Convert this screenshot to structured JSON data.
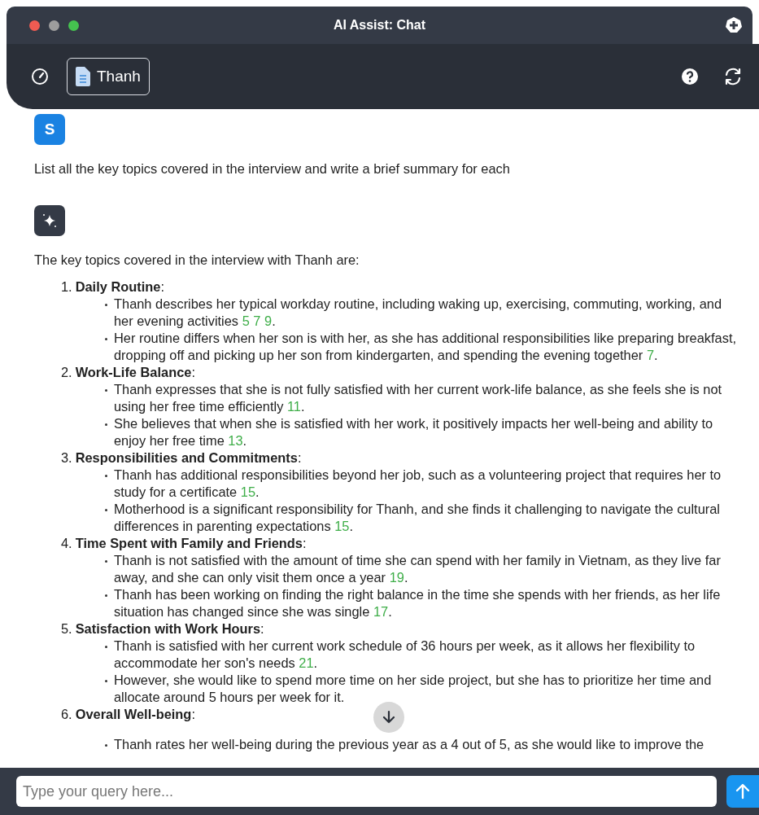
{
  "window": {
    "title": "AI Assist: Chat"
  },
  "toolbar": {
    "document_button": "Thanh"
  },
  "messages": [
    {
      "kind": "user",
      "avatar": "S",
      "text": "List all the key topics covered in the interview and write a brief summary for each"
    },
    {
      "kind": "assistant",
      "intro": "The key topics covered in the interview with Thanh are:",
      "topics": [
        {
          "number": "1.",
          "title": "Daily Routine",
          "after": ":",
          "bullets": [
            {
              "text": "Thanh describes her typical workday routine, including waking up, exercising, commuting, working, and her evening activities",
              "citations": [
                "5",
                "7",
                "9"
              ],
              "end": "."
            },
            {
              "text": "Her routine differs when her son is with her, as she has additional responsibilities like preparing breakfast, dropping off and picking up her son from kindergarten, and spending the evening together",
              "citations": [
                "7"
              ],
              "end": "."
            }
          ]
        },
        {
          "number": "2.",
          "title": "Work-Life Balance",
          "after": ":",
          "bullets": [
            {
              "text": "Thanh expresses that she is not fully satisfied with her current work-life balance, as she feels she is not using her free time efficiently",
              "citations": [
                "11"
              ],
              "end": "."
            },
            {
              "text": "She believes that when she is satisfied with her work, it positively impacts her well-being and ability to enjoy her free time",
              "citations": [
                "13"
              ],
              "end": "."
            }
          ]
        },
        {
          "number": "3.",
          "title": "Responsibilities and Commitments",
          "after": ":",
          "bullets": [
            {
              "text": "Thanh has additional responsibilities beyond her job, such as a volunteering project that requires her to study for a certificate",
              "citations": [
                "15"
              ],
              "end": "."
            },
            {
              "text": "Motherhood is a significant responsibility for Thanh, and she finds it challenging to navigate the cultural differences in parenting expectations",
              "citations": [
                "15"
              ],
              "end": "."
            }
          ]
        },
        {
          "number": "4.",
          "title": "Time Spent with Family and Friends",
          "after": ":",
          "bullets": [
            {
              "text": "Thanh is not satisfied with the amount of time she can spend with her family in Vietnam, as they live far away, and she can only visit them once a year",
              "citations": [
                "19"
              ],
              "end": "."
            },
            {
              "text": "Thanh has been working on finding the right balance in the time she spends with her friends, as her life situation has changed since she was single",
              "citations": [
                "17"
              ],
              "end": "."
            }
          ]
        },
        {
          "number": "5.",
          "title": "Satisfaction with Work Hours",
          "after": ":",
          "bullets": [
            {
              "text": "Thanh is satisfied with her current work schedule of 36 hours per week, as it allows her flexibility to accommodate her son's needs",
              "citations": [
                "21"
              ],
              "end": "."
            },
            {
              "text": "However, she would like to spend more time on her side project, but she has to prioritize her time and allocate around 5 hours per week for it",
              "end": "."
            }
          ]
        },
        {
          "number": "6.",
          "title": "Overall Well-being",
          "after": ":",
          "bullets": [
            {
              "text": "Thanh rates her well-being during the previous year as a 4 out of 5, as she would like to improve the"
            }
          ]
        }
      ]
    }
  ],
  "input": {
    "placeholder": "Type your query here..."
  }
}
